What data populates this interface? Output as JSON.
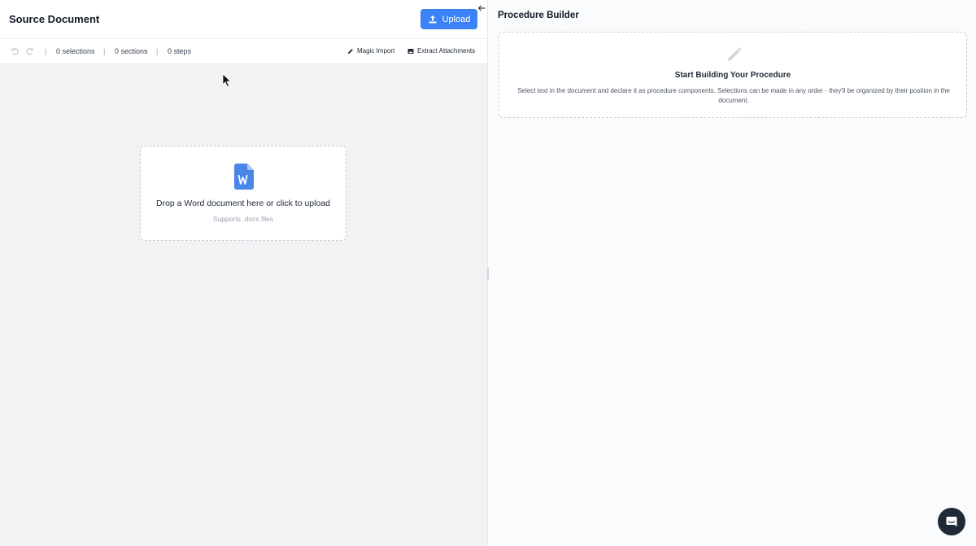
{
  "source": {
    "title": "Source Document",
    "upload_label": "Upload",
    "toolbar": {
      "selections": "0 selections",
      "sections": "0 sections",
      "steps": "0 steps",
      "separator": "|",
      "magic_import": "Magic Import",
      "extract_attachments": "Extract Attachments"
    },
    "dropzone": {
      "text": "Drop a Word document here or click to upload",
      "subtext": "Supports .docx files",
      "icon": "word-document-icon"
    }
  },
  "builder": {
    "title": "Procedure Builder",
    "empty_title": "Start Building Your Procedure",
    "empty_description": "Select text in the document and declare it as procedure components. Selections can be made in any order - they'll be organized by their position in the document."
  },
  "colors": {
    "accent": "#3b82f6",
    "word_blue": "#4a86e8",
    "chat_bg": "#1f2937"
  }
}
